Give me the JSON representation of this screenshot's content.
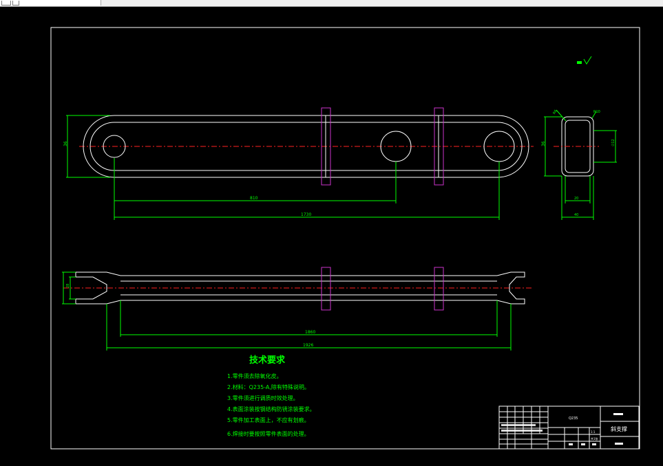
{
  "dimensions": {
    "top_center_span": "810",
    "top_total_span": "1730",
    "top_height": "36",
    "section_height": "36",
    "section_inner_width": "20",
    "section_outer_width": "40",
    "section_right_dim": "∅12",
    "section_corner_left": "R6",
    "section_corner_right": "R10",
    "bottom_inner_span": "1860",
    "bottom_outer_span": "1926",
    "bottom_fork_height": "28"
  },
  "tech_requirements": {
    "title": "技术要求",
    "items": [
      "1.零件须去除氧化皮。",
      "2.材料：Q235-A,除有特殊说明。",
      "3.零件须进行调质时效处理。",
      "4.表面涂装按钢结构防锈涂装要求。",
      "5.零件加工表面上，不应有划痕。",
      "6.焊接时要按照零件表面的处理。"
    ]
  },
  "title_block": {
    "part_name": "斜支撑",
    "material": "Q235",
    "scale": "1:1",
    "sheet": "共1张"
  },
  "colors": {
    "background": "#000000",
    "outline": "#ffffff",
    "dimension": "#00ff00",
    "centerline": "#ff2020",
    "plate": "#cc33cc",
    "text": "#00ff00"
  }
}
